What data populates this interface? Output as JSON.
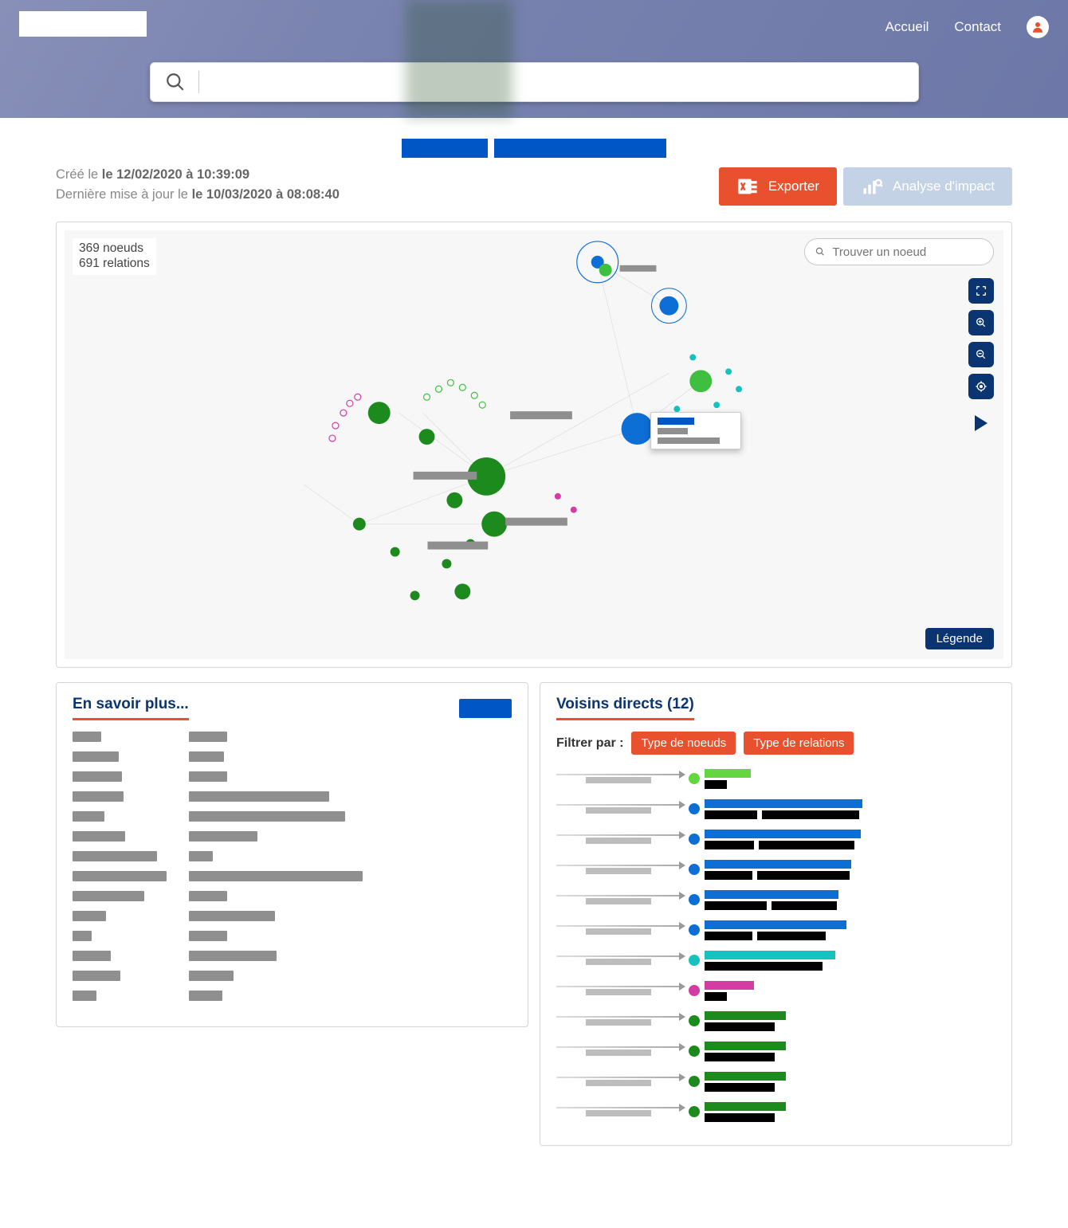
{
  "header": {
    "nav": {
      "home": "Accueil",
      "contact": "Contact"
    },
    "search_placeholder": ""
  },
  "meta": {
    "created_prefix": "Créé le ",
    "created_value": "le 12/02/2020 à 10:39:09",
    "updated_prefix": "Dernière mise à jour le ",
    "updated_value": "le 10/03/2020 à 08:08:40"
  },
  "actions": {
    "export": "Exporter",
    "impact": "Analyse d'impact"
  },
  "graph": {
    "nodes": "369 noeuds",
    "rels": "691 relations",
    "find_placeholder": "Trouver un noeud",
    "legend": "Légende"
  },
  "more": {
    "title": "En savoir plus...",
    "rows": [
      {
        "kw": 36,
        "vw": 48
      },
      {
        "kw": 58,
        "vw": 44
      },
      {
        "kw": 62,
        "vw": 48
      },
      {
        "kw": 64,
        "vw": 176
      },
      {
        "kw": 40,
        "vw": 196
      },
      {
        "kw": 66,
        "vw": 86
      },
      {
        "kw": 106,
        "vw": 30
      },
      {
        "kw": 118,
        "vw": 218
      },
      {
        "kw": 90,
        "vw": 48
      },
      {
        "kw": 42,
        "vw": 108
      },
      {
        "kw": 24,
        "vw": 48
      },
      {
        "kw": 48,
        "vw": 110
      },
      {
        "kw": 60,
        "vw": 56
      },
      {
        "kw": 30,
        "vw": 42
      }
    ]
  },
  "neighbors": {
    "title": "Voisins directs (12)",
    "filter_label": "Filtrer par :",
    "filter_nodes": "Type de noeuds",
    "filter_rels": "Type de relations",
    "items": [
      {
        "dot": "lime",
        "w1": 58,
        "w2": 28
      },
      {
        "dot": "blue",
        "w1": 198,
        "w2a": 66,
        "w2b": 122
      },
      {
        "dot": "blue",
        "w1": 196,
        "w2a": 62,
        "w2b": 120
      },
      {
        "dot": "blue",
        "w1": 184,
        "w2a": 60,
        "w2b": 116
      },
      {
        "dot": "blue",
        "w1": 168,
        "w2a": 78,
        "w2b": 82
      },
      {
        "dot": "blue",
        "w1": 178,
        "w2a": 60,
        "w2b": 86
      },
      {
        "dot": "teal",
        "w1": 164,
        "w2": 148
      },
      {
        "dot": "mag",
        "w1": 62,
        "w2": 28
      },
      {
        "dot": "green",
        "w1": 102,
        "w2": 88
      },
      {
        "dot": "green",
        "w1": 102,
        "w2": 88
      },
      {
        "dot": "green",
        "w1": 102,
        "w2": 88
      },
      {
        "dot": "green",
        "w1": 102,
        "w2": 88
      }
    ]
  }
}
